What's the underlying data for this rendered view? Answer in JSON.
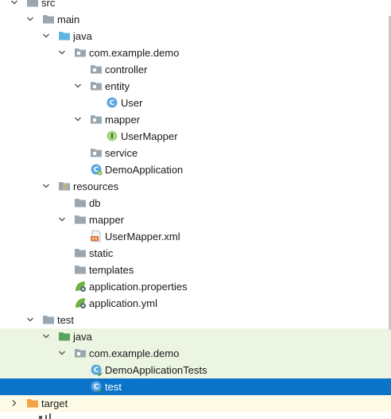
{
  "tree": [
    {
      "label": "src",
      "depth": 0,
      "expander": "down",
      "icon": "folder-icon"
    },
    {
      "label": "main",
      "depth": 1,
      "expander": "down",
      "icon": "folder-icon"
    },
    {
      "label": "java",
      "depth": 2,
      "expander": "down",
      "icon": "source-folder-icon"
    },
    {
      "label": "com.example.demo",
      "depth": 3,
      "expander": "down",
      "icon": "package-icon"
    },
    {
      "label": "controller",
      "depth": 4,
      "expander": "none",
      "icon": "package-icon"
    },
    {
      "label": "entity",
      "depth": 4,
      "expander": "down",
      "icon": "package-icon"
    },
    {
      "label": "User",
      "depth": 5,
      "expander": "none",
      "icon": "class-icon"
    },
    {
      "label": "mapper",
      "depth": 4,
      "expander": "down",
      "icon": "package-icon"
    },
    {
      "label": "UserMapper",
      "depth": 5,
      "expander": "none",
      "icon": "interface-icon"
    },
    {
      "label": "service",
      "depth": 4,
      "expander": "none",
      "icon": "package-icon"
    },
    {
      "label": "DemoApplication",
      "depth": 4,
      "expander": "none",
      "icon": "spring-boot-class-icon"
    },
    {
      "label": "resources",
      "depth": 2,
      "expander": "down",
      "icon": "resources-folder-icon"
    },
    {
      "label": "db",
      "depth": 3,
      "expander": "none",
      "icon": "folder-icon"
    },
    {
      "label": "mapper",
      "depth": 3,
      "expander": "down",
      "icon": "folder-icon"
    },
    {
      "label": "UserMapper.xml",
      "depth": 4,
      "expander": "none",
      "icon": "xml-file-icon"
    },
    {
      "label": "static",
      "depth": 3,
      "expander": "none",
      "icon": "folder-icon"
    },
    {
      "label": "templates",
      "depth": 3,
      "expander": "none",
      "icon": "folder-icon"
    },
    {
      "label": "application.properties",
      "depth": 3,
      "expander": "none",
      "icon": "spring-properties-icon"
    },
    {
      "label": "application.yml",
      "depth": 3,
      "expander": "none",
      "icon": "spring-yml-icon"
    },
    {
      "label": "test",
      "depth": 1,
      "expander": "down",
      "icon": "folder-icon"
    },
    {
      "label": "java",
      "depth": 2,
      "expander": "down",
      "icon": "test-source-folder-icon",
      "bg": "test"
    },
    {
      "label": "com.example.demo",
      "depth": 3,
      "expander": "down",
      "icon": "package-icon",
      "bg": "test"
    },
    {
      "label": "DemoApplicationTests",
      "depth": 4,
      "expander": "none",
      "icon": "test-class-icon",
      "bg": "test"
    },
    {
      "label": "test",
      "depth": 4,
      "expander": "none",
      "icon": "test-class-icon",
      "bg": "selected"
    },
    {
      "label": "target",
      "depth": 0,
      "expander": "right",
      "icon": "excluded-folder-icon",
      "bg": "target"
    }
  ],
  "colors": {
    "folder": "#9aa7b0",
    "source_folder": "#62b4e0",
    "test_folder": "#5ba25b",
    "excluded_folder": "#f0a445",
    "selection": "#0b74c8",
    "test_row_bg": "#ebf5e2",
    "target_row_bg": "#fdfbe6"
  }
}
